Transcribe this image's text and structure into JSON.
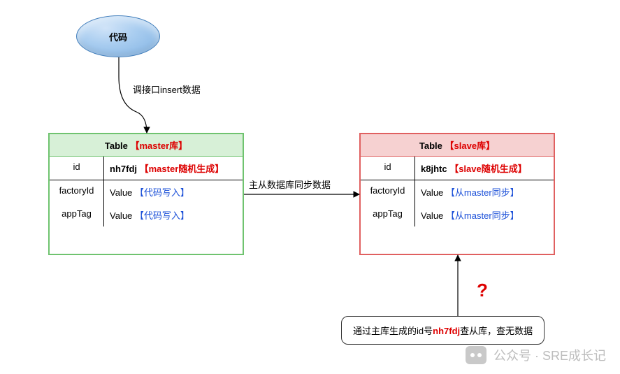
{
  "ellipse": {
    "label": "代码"
  },
  "edges": {
    "insert": "调接口insert数据",
    "sync": "主从数据库同步数据"
  },
  "master": {
    "title_prefix": "Table",
    "title_red": "【master库】",
    "rows": {
      "id": {
        "key": "id",
        "val_bold": "nh7fdj",
        "val_note": "【master随机生成】"
      },
      "factoryId": {
        "key": "factoryId",
        "val": "Value",
        "val_note": "【代码写入】"
      },
      "appTag": {
        "key": "appTag",
        "val": "Value",
        "val_note": "【代码写入】"
      }
    }
  },
  "slave": {
    "title_prefix": "Table",
    "title_red": "【slave库】",
    "rows": {
      "id": {
        "key": "id",
        "val_bold": "k8jhtc",
        "val_note": "【slave随机生成】"
      },
      "factoryId": {
        "key": "factoryId",
        "val": "Value",
        "val_note": "【从master同步】"
      },
      "appTag": {
        "key": "appTag",
        "val": "Value",
        "val_note": "【从master同步】"
      }
    }
  },
  "question_mark": "?",
  "query": {
    "pre": "通过主库生成的id号",
    "id": "nh7fdj",
    "post": "查从库，查无数据"
  },
  "watermark": "公众号 · SRE成长记"
}
